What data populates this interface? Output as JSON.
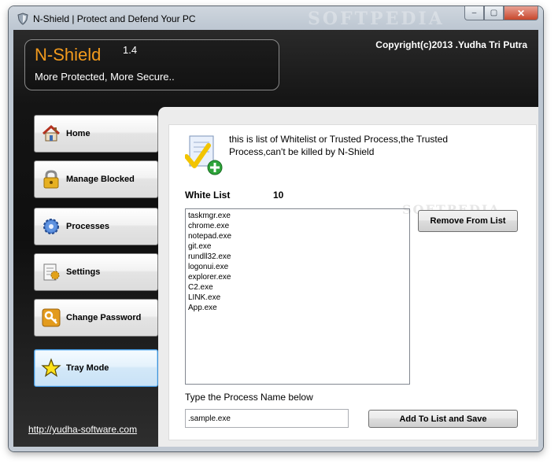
{
  "window": {
    "title": "N-Shield | Protect and Defend Your PC",
    "watermark": "SOFTPEDIA",
    "controls": {
      "minimize": "–",
      "maximize": "▢",
      "close": "✕"
    }
  },
  "header": {
    "app_name": "N-Shield",
    "version": "1.4",
    "tagline": "More Protected, More Secure..",
    "copyright": "Copyright(c)2013 .Yudha Tri Putra"
  },
  "sidebar": {
    "items": [
      {
        "label": "Home",
        "icon": "home-icon"
      },
      {
        "label": "Manage Blocked",
        "icon": "lock-icon"
      },
      {
        "label": "Processes",
        "icon": "gear-icon"
      },
      {
        "label": "Settings",
        "icon": "settings-icon"
      },
      {
        "label": "Change Password",
        "icon": "key-icon"
      },
      {
        "label": "Tray Mode",
        "icon": "star-icon",
        "active": true
      }
    ],
    "website": "http://yudha-software.com"
  },
  "main": {
    "description": "this is list of Whitelist or Trusted Process,the Trusted Process,can't be killed by N-Shield",
    "whitelist_label": "White List",
    "whitelist_count": "10",
    "watermark": "SOFTPEDIA",
    "whitelist": [
      "taskmgr.exe",
      "chrome.exe",
      "notepad.exe",
      "git.exe",
      "rundll32.exe",
      "logonui.exe",
      "explorer.exe",
      "C2.exe",
      "LINK.exe",
      "App.exe"
    ],
    "remove_button": "Remove From List",
    "type_label": "Type the Process Name below",
    "process_input_value": ".sample.exe",
    "add_button": "Add To List and Save"
  },
  "colors": {
    "brand_orange": "#f29a1d",
    "active_border": "#3c8fd6",
    "header_bg": "#141414"
  }
}
